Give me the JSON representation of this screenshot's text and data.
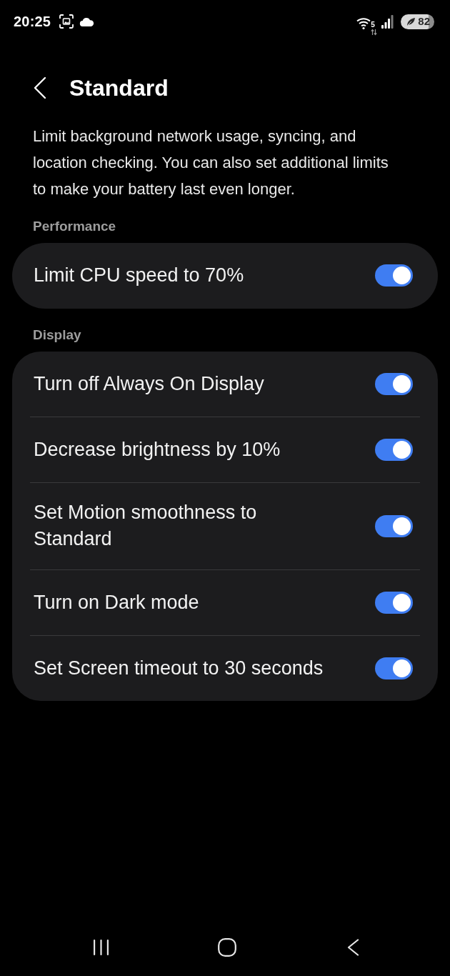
{
  "status_bar": {
    "time": "20:25",
    "wifi_badge": "5",
    "battery": "82"
  },
  "header": {
    "title": "Standard"
  },
  "description": "Limit background network usage, syncing, and location checking. You can also set additional limits to make your battery last even longer.",
  "sections": [
    {
      "title": "Performance",
      "items": [
        {
          "label": "Limit CPU speed to 70%",
          "on": true
        }
      ]
    },
    {
      "title": "Display",
      "items": [
        {
          "label": "Turn off Always On Display",
          "on": true
        },
        {
          "label": "Decrease brightness by 10%",
          "on": true
        },
        {
          "label": "Set Motion smoothness to Standard",
          "on": true
        },
        {
          "label": "Turn on Dark mode",
          "on": true
        },
        {
          "label": "Set Screen timeout to 30 seconds",
          "on": true
        }
      ]
    }
  ]
}
